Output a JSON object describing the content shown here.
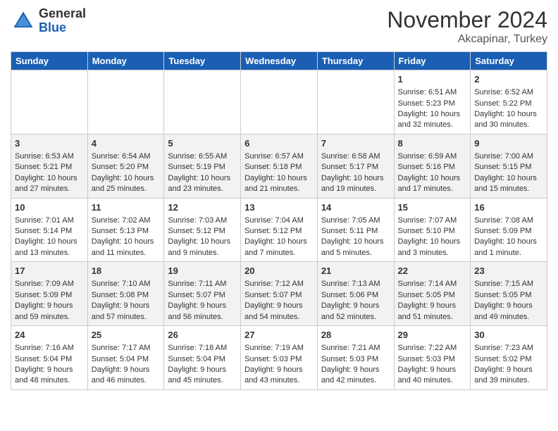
{
  "logo": {
    "general": "General",
    "blue": "Blue"
  },
  "header": {
    "month": "November 2024",
    "location": "Akcapinar, Turkey"
  },
  "days_of_week": [
    "Sunday",
    "Monday",
    "Tuesday",
    "Wednesday",
    "Thursday",
    "Friday",
    "Saturday"
  ],
  "weeks": [
    [
      {
        "day": "",
        "info": ""
      },
      {
        "day": "",
        "info": ""
      },
      {
        "day": "",
        "info": ""
      },
      {
        "day": "",
        "info": ""
      },
      {
        "day": "",
        "info": ""
      },
      {
        "day": "1",
        "info": "Sunrise: 6:51 AM\nSunset: 5:23 PM\nDaylight: 10 hours and 32 minutes."
      },
      {
        "day": "2",
        "info": "Sunrise: 6:52 AM\nSunset: 5:22 PM\nDaylight: 10 hours and 30 minutes."
      }
    ],
    [
      {
        "day": "3",
        "info": "Sunrise: 6:53 AM\nSunset: 5:21 PM\nDaylight: 10 hours and 27 minutes."
      },
      {
        "day": "4",
        "info": "Sunrise: 6:54 AM\nSunset: 5:20 PM\nDaylight: 10 hours and 25 minutes."
      },
      {
        "day": "5",
        "info": "Sunrise: 6:55 AM\nSunset: 5:19 PM\nDaylight: 10 hours and 23 minutes."
      },
      {
        "day": "6",
        "info": "Sunrise: 6:57 AM\nSunset: 5:18 PM\nDaylight: 10 hours and 21 minutes."
      },
      {
        "day": "7",
        "info": "Sunrise: 6:58 AM\nSunset: 5:17 PM\nDaylight: 10 hours and 19 minutes."
      },
      {
        "day": "8",
        "info": "Sunrise: 6:59 AM\nSunset: 5:16 PM\nDaylight: 10 hours and 17 minutes."
      },
      {
        "day": "9",
        "info": "Sunrise: 7:00 AM\nSunset: 5:15 PM\nDaylight: 10 hours and 15 minutes."
      }
    ],
    [
      {
        "day": "10",
        "info": "Sunrise: 7:01 AM\nSunset: 5:14 PM\nDaylight: 10 hours and 13 minutes."
      },
      {
        "day": "11",
        "info": "Sunrise: 7:02 AM\nSunset: 5:13 PM\nDaylight: 10 hours and 11 minutes."
      },
      {
        "day": "12",
        "info": "Sunrise: 7:03 AM\nSunset: 5:12 PM\nDaylight: 10 hours and 9 minutes."
      },
      {
        "day": "13",
        "info": "Sunrise: 7:04 AM\nSunset: 5:12 PM\nDaylight: 10 hours and 7 minutes."
      },
      {
        "day": "14",
        "info": "Sunrise: 7:05 AM\nSunset: 5:11 PM\nDaylight: 10 hours and 5 minutes."
      },
      {
        "day": "15",
        "info": "Sunrise: 7:07 AM\nSunset: 5:10 PM\nDaylight: 10 hours and 3 minutes."
      },
      {
        "day": "16",
        "info": "Sunrise: 7:08 AM\nSunset: 5:09 PM\nDaylight: 10 hours and 1 minute."
      }
    ],
    [
      {
        "day": "17",
        "info": "Sunrise: 7:09 AM\nSunset: 5:09 PM\nDaylight: 9 hours and 59 minutes."
      },
      {
        "day": "18",
        "info": "Sunrise: 7:10 AM\nSunset: 5:08 PM\nDaylight: 9 hours and 57 minutes."
      },
      {
        "day": "19",
        "info": "Sunrise: 7:11 AM\nSunset: 5:07 PM\nDaylight: 9 hours and 56 minutes."
      },
      {
        "day": "20",
        "info": "Sunrise: 7:12 AM\nSunset: 5:07 PM\nDaylight: 9 hours and 54 minutes."
      },
      {
        "day": "21",
        "info": "Sunrise: 7:13 AM\nSunset: 5:06 PM\nDaylight: 9 hours and 52 minutes."
      },
      {
        "day": "22",
        "info": "Sunrise: 7:14 AM\nSunset: 5:05 PM\nDaylight: 9 hours and 51 minutes."
      },
      {
        "day": "23",
        "info": "Sunrise: 7:15 AM\nSunset: 5:05 PM\nDaylight: 9 hours and 49 minutes."
      }
    ],
    [
      {
        "day": "24",
        "info": "Sunrise: 7:16 AM\nSunset: 5:04 PM\nDaylight: 9 hours and 48 minutes."
      },
      {
        "day": "25",
        "info": "Sunrise: 7:17 AM\nSunset: 5:04 PM\nDaylight: 9 hours and 46 minutes."
      },
      {
        "day": "26",
        "info": "Sunrise: 7:18 AM\nSunset: 5:04 PM\nDaylight: 9 hours and 45 minutes."
      },
      {
        "day": "27",
        "info": "Sunrise: 7:19 AM\nSunset: 5:03 PM\nDaylight: 9 hours and 43 minutes."
      },
      {
        "day": "28",
        "info": "Sunrise: 7:21 AM\nSunset: 5:03 PM\nDaylight: 9 hours and 42 minutes."
      },
      {
        "day": "29",
        "info": "Sunrise: 7:22 AM\nSunset: 5:03 PM\nDaylight: 9 hours and 40 minutes."
      },
      {
        "day": "30",
        "info": "Sunrise: 7:23 AM\nSunset: 5:02 PM\nDaylight: 9 hours and 39 minutes."
      }
    ]
  ]
}
